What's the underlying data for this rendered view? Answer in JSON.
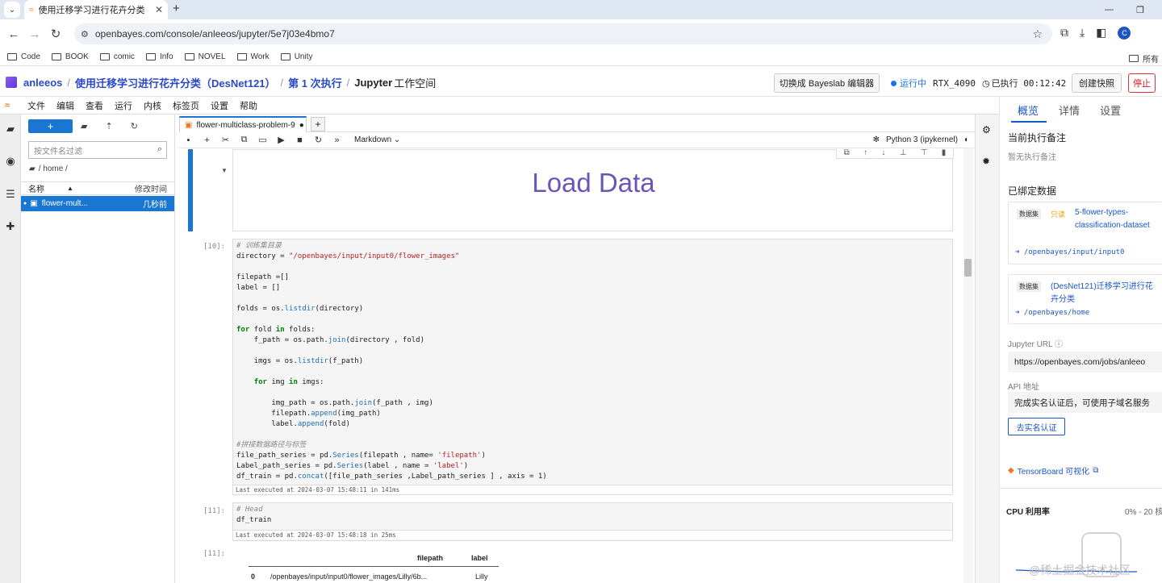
{
  "browser": {
    "tab_title": "使用迁移学习进行花卉分类（D",
    "url": "openbayes.com/console/anleeos/jupyter/5e7j03e4bmo7",
    "bookmarks": [
      "Code",
      "BOOK",
      "comic",
      "Info",
      "NOVEL",
      "Work",
      "Unity"
    ],
    "bookmarks_right": "所有",
    "avatar_letter": "C"
  },
  "app": {
    "user": "anleeos",
    "project": "使用迁移学习进行花卉分类（DesNet121）",
    "run": "第 1 次执行",
    "workspace_prefix": "Jupyter",
    "workspace_suffix": "工作空间",
    "switch_btn": "切换成 Bayeslab 编辑器",
    "status": "运行中",
    "gpu": "RTX_4090",
    "elapsed": "已执行 00:12:42",
    "snapshot_btn": "创建快照",
    "stop_btn": "停止"
  },
  "jupyter_menu": [
    "文件",
    "编辑",
    "查看",
    "运行",
    "内核",
    "标签页",
    "设置",
    "帮助"
  ],
  "filebrowser": {
    "search_placeholder": "按文件名过滤",
    "path": "/ home /",
    "col_name": "名称",
    "col_modified": "修改时间",
    "file_name": "flower-mult...",
    "file_modified": "几秒前"
  },
  "notebook": {
    "tab": "flower-multiclass-problem-9",
    "cell_type": "Markdown",
    "kernel": "Python 3 (ipykernel)",
    "markdown_heading": "Load Data",
    "cell10_prompt": "[10]:",
    "cell10_exec": "Last executed at 2024-03-07 15:48:11 in 141ms",
    "cell11_prompt": "[11]:",
    "cell11_exec": "Last executed at 2024-03-07 15:48:18 in 25ms",
    "cell11_out_prompt": "[11]:",
    "table_headers": [
      "filepath",
      "label"
    ],
    "table_row": [
      "0",
      "/openbayes/input/input0/flower_images/Lilly/6b...",
      "Lilly"
    ]
  },
  "right_panel": {
    "tabs": [
      "概览",
      "详情",
      "设置"
    ],
    "note_title": "当前执行备注",
    "note_empty": "暂无执行备注",
    "bound_title": "已绑定数据",
    "dataset1_tag": "数据集",
    "dataset1_ro": "只读",
    "dataset1_name": "5-flower-types-classification-dataset",
    "dataset1_path": "/openbayes/input/input0",
    "dataset2_tag": "数据集",
    "dataset2_name": "(DesNet121)迁移学习进行花卉分类",
    "dataset2_path": "/openbayes/home",
    "jupyter_url_label": "Jupyter URL",
    "jupyter_url": "https://openbayes.com/jobs/anleeo",
    "api_label": "API 地址",
    "api_text": "完成实名认证后，可使用子域名服务",
    "verify_btn": "去实名认证",
    "tensorboard": "TensorBoard 可视化",
    "cpu_label": "CPU 利用率",
    "cpu_range": "0% - 20 核"
  },
  "overlay": {
    "watermark": "@稀土掘金技术社区"
  }
}
